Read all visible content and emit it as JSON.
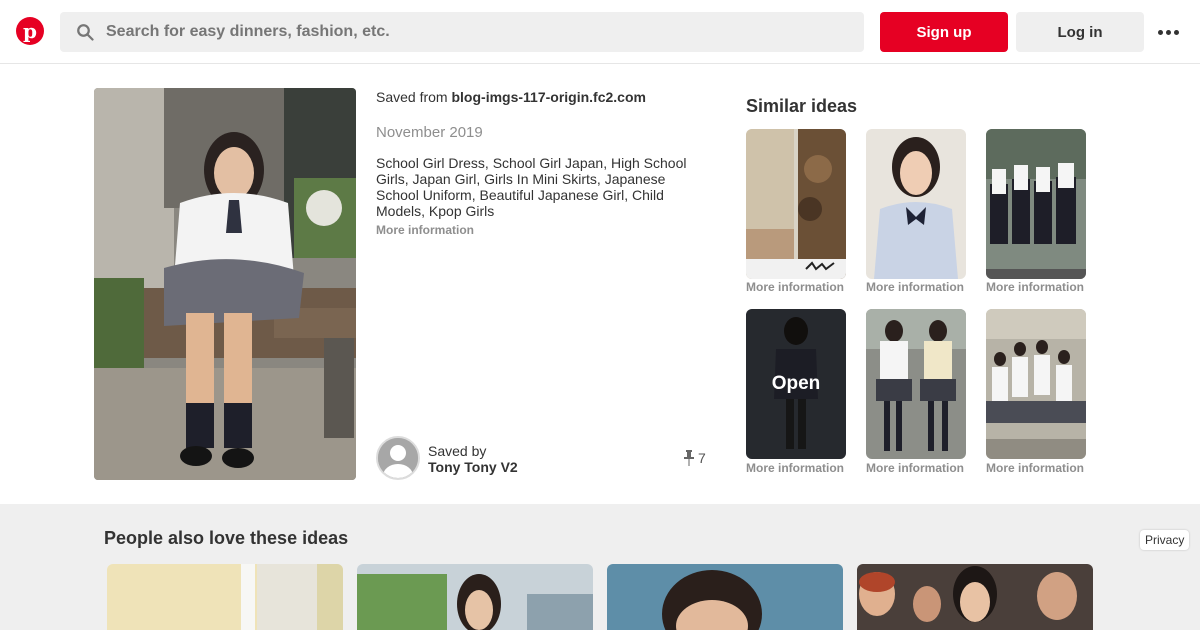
{
  "header": {
    "logo_letter": "p",
    "search_placeholder": "Search for easy dinners, fashion, etc.",
    "signup_label": "Sign up",
    "login_label": "Log in"
  },
  "pin": {
    "saved_from_prefix": "Saved from",
    "source": "blog-imgs-117-origin.fc2.com",
    "date": "November 2019",
    "description": "School Girl Dress, School Girl Japan, High School Girls, Japan Girl, Girls In Mini Skirts, Japanese School Uniform, Beautiful Japanese Girl, Child Models, Kpop Girls",
    "more_info": "More information",
    "saved_by_label": "Saved by",
    "saver_name": "Tony Tony V2",
    "repin_count": "7"
  },
  "similar": {
    "title": "Similar ideas",
    "items": [
      {
        "more_info": "More information"
      },
      {
        "more_info": "More information"
      },
      {
        "more_info": "More information"
      },
      {
        "more_info": "More information",
        "overlay": "Open"
      },
      {
        "more_info": "More information"
      },
      {
        "more_info": "More information"
      }
    ]
  },
  "bottom": {
    "title": "People also love these ideas",
    "privacy_label": "Privacy"
  },
  "colors": {
    "brand_red": "#e60023",
    "button_gray": "#efefef",
    "muted_text": "#8e8e8e"
  },
  "icons": [
    "pinterest-logo-icon",
    "search-icon",
    "more-menu-icon",
    "pushpin-icon",
    "avatar-placeholder-icon"
  ]
}
